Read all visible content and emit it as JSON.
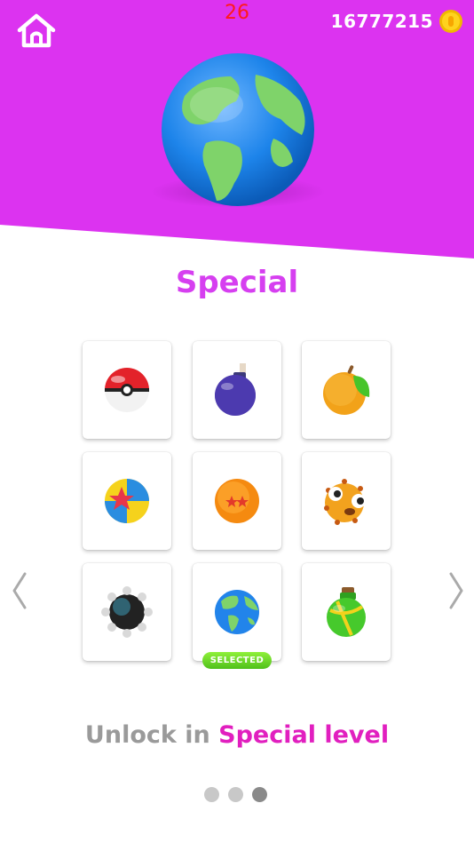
{
  "header": {
    "fps": "26",
    "coins": "16777215",
    "coin_icon": "coin-icon",
    "home_icon": "home-icon"
  },
  "hero": {
    "ball": "earth-ball",
    "background_color": "#dc33f0"
  },
  "category": {
    "title": "Special"
  },
  "balls": [
    {
      "name": "pokeball"
    },
    {
      "name": "bomb"
    },
    {
      "name": "orange"
    },
    {
      "name": "star-ball"
    },
    {
      "name": "dragon-ball"
    },
    {
      "name": "pufferfish"
    },
    {
      "name": "spiked-mine"
    },
    {
      "name": "earth",
      "selected": true
    },
    {
      "name": "potion"
    }
  ],
  "selected_label": "SELECTED",
  "unlock": {
    "prefix": "Unlock in",
    "level": "Special level"
  },
  "pagination": {
    "pages": 3,
    "active": 3
  },
  "colors": {
    "accent_pink": "#d63ff0",
    "unlock_pink": "#e11fbf",
    "selected_green": "#5cc820"
  }
}
